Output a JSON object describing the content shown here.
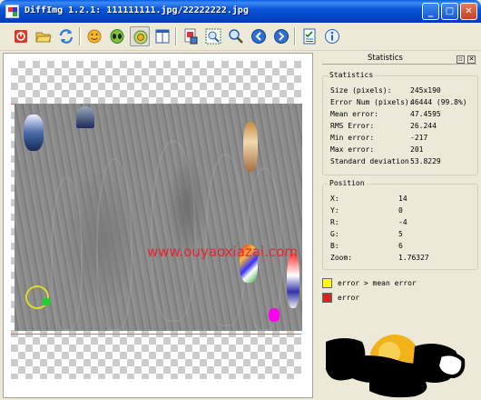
{
  "window": {
    "title": "DiffImg 1.2.1: 111111111.jpg/22222222.jpg",
    "minimize": "_",
    "maximize": "□",
    "close": "✕"
  },
  "toolbar": {
    "buttons": [
      {
        "icon": "quit-icon"
      },
      {
        "icon": "open-folder-icon"
      },
      {
        "icon": "refresh-icon"
      },
      {
        "icon": "smiley-icon"
      },
      {
        "icon": "alien-icon"
      },
      {
        "icon": "diff-view-icon",
        "active": true
      },
      {
        "icon": "dual-panel-icon"
      },
      {
        "icon": "save-mask-icon"
      },
      {
        "icon": "fit-zoom-icon"
      },
      {
        "icon": "zoom-icon"
      },
      {
        "icon": "previous-icon"
      },
      {
        "icon": "next-icon"
      },
      {
        "icon": "preferences-icon"
      },
      {
        "icon": "info-icon"
      }
    ]
  },
  "image_area": {
    "watermark": "www.ouyaoxiazai.com"
  },
  "statistics_panel": {
    "dock_title": "Statistics",
    "float_button": "▫",
    "close_button": "✕",
    "stats_group_title": "Statistics",
    "stats": [
      {
        "label": "Size (pixels):",
        "value": "245x190"
      },
      {
        "label": "Error Num (pixels):",
        "value": "46444 (99.8%)"
      },
      {
        "label": "Mean error:",
        "value": "47.4595"
      },
      {
        "label": "RMS Error:",
        "value": "26.244"
      },
      {
        "label": "Min error:",
        "value": "-217"
      },
      {
        "label": "Max error:",
        "value": "201"
      },
      {
        "label": "Standard deviation",
        "value": "53.8229"
      }
    ],
    "position_group_title": "Position",
    "position": [
      {
        "label": "X:",
        "value": "14"
      },
      {
        "label": "Y:",
        "value": "0"
      },
      {
        "label": "R:",
        "value": "-4"
      },
      {
        "label": "G:",
        "value": "5"
      },
      {
        "label": "B:",
        "value": "6"
      },
      {
        "label": "Zoom:",
        "value": "1.76327"
      }
    ],
    "legend": [
      {
        "label": "error > mean error",
        "color": "#ffff00"
      },
      {
        "label": "error",
        "color": "#e02020"
      }
    ]
  }
}
